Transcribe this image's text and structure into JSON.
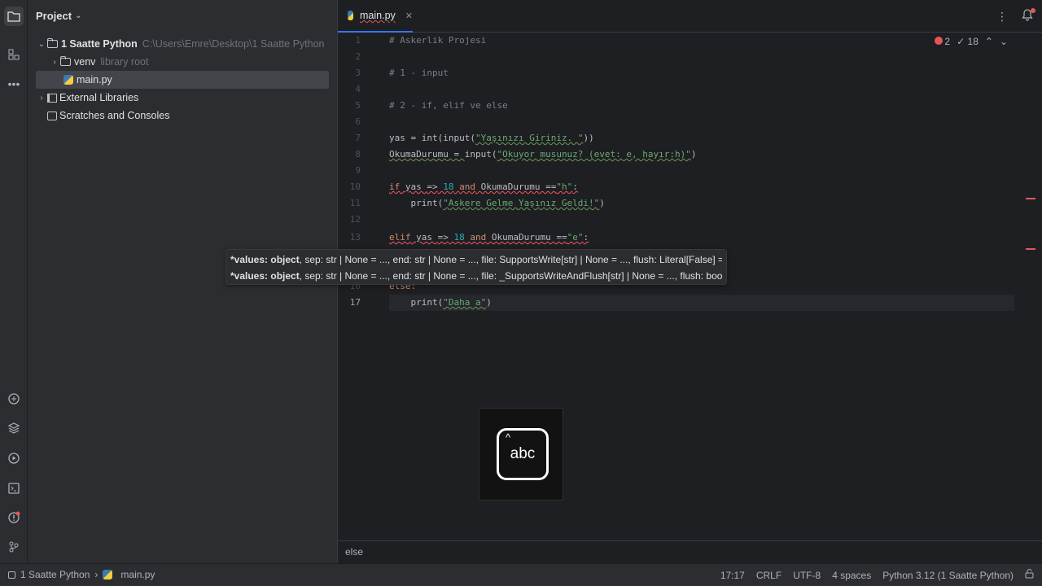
{
  "project_panel": {
    "title": "Project",
    "tree": [
      {
        "label": "1 Saatte Python",
        "hint": "C:\\Users\\Emre\\Desktop\\1 Saatte Python"
      },
      {
        "label": "venv",
        "hint": "library root"
      },
      {
        "label": "main.py"
      },
      {
        "label": "External Libraries"
      },
      {
        "label": "Scratches and Consoles"
      }
    ]
  },
  "editor": {
    "tab_label": "main.py",
    "inspection": {
      "errors": "2",
      "checks": "18"
    },
    "line_numbers": [
      "1",
      "2",
      "3",
      "4",
      "5",
      "6",
      "7",
      "8",
      "9",
      "10",
      "11",
      "12",
      "13",
      "16",
      "17"
    ],
    "code": {
      "l1": "# Askerlik Projesi",
      "l3": "# 1 - input",
      "l5": "# 2 - if, elif ve else",
      "l7_a": "yas = ",
      "l7_b": "int",
      "l7_c": "(",
      "l7_d": "input",
      "l7_e": "(",
      "l7_f": "\"Yaşınızı Giriniz. \"",
      "l7_g": "))",
      "l8_a": "OkumaDurumu = ",
      "l8_b": "input",
      "l8_c": "(",
      "l8_d": "\"Okuyor musunuz? (evet: e, hayır:h)\"",
      "l8_e": ")",
      "l10_a": "if",
      "l10_b": " yas ",
      "l10_c": "=>",
      "l10_d": "18",
      "l10_e": "and",
      "l10_f": " OkumaDurumu ==",
      "l10_g": "\"h\"",
      "l10_h": ":",
      "l11_a": "    print(",
      "l11_b": "\"Askere Gelme Yaşınız Geldi!\"",
      "l11_c": ")",
      "l13_a": "elif",
      "l13_b": " yas ",
      "l13_c": "=>",
      "l13_d": "18",
      "l13_e": "and",
      "l13_f": " OkumaDurumu ==",
      "l13_g": "\"e\"",
      "l13_h": ":",
      "l16": "else:",
      "l17_a": "    print(",
      "l17_b": "\"Daha a\"",
      "l17_c": ")"
    },
    "breadcrumb": "else"
  },
  "param_hint": {
    "row1_bold": "*values: object",
    "row1_rest": ", sep: str | None = ..., end: str | None = ..., file: SupportsWrite[str] | None = ..., flush: Literal[False] = ...",
    "row2_bold": "*values: object",
    "row2_rest": ", sep: str | None = ..., end: str | None = ..., file: _SupportsWriteAndFlush[str] | None = ..., flush: bool"
  },
  "keystroke": "abc",
  "statusbar": {
    "project": "1 Saatte Python",
    "file": "main.py",
    "position": "17:17",
    "line_sep": "CRLF",
    "encoding": "UTF-8",
    "indent": "4 spaces",
    "interpreter": "Python 3.12 (1 Saatte Python)"
  }
}
